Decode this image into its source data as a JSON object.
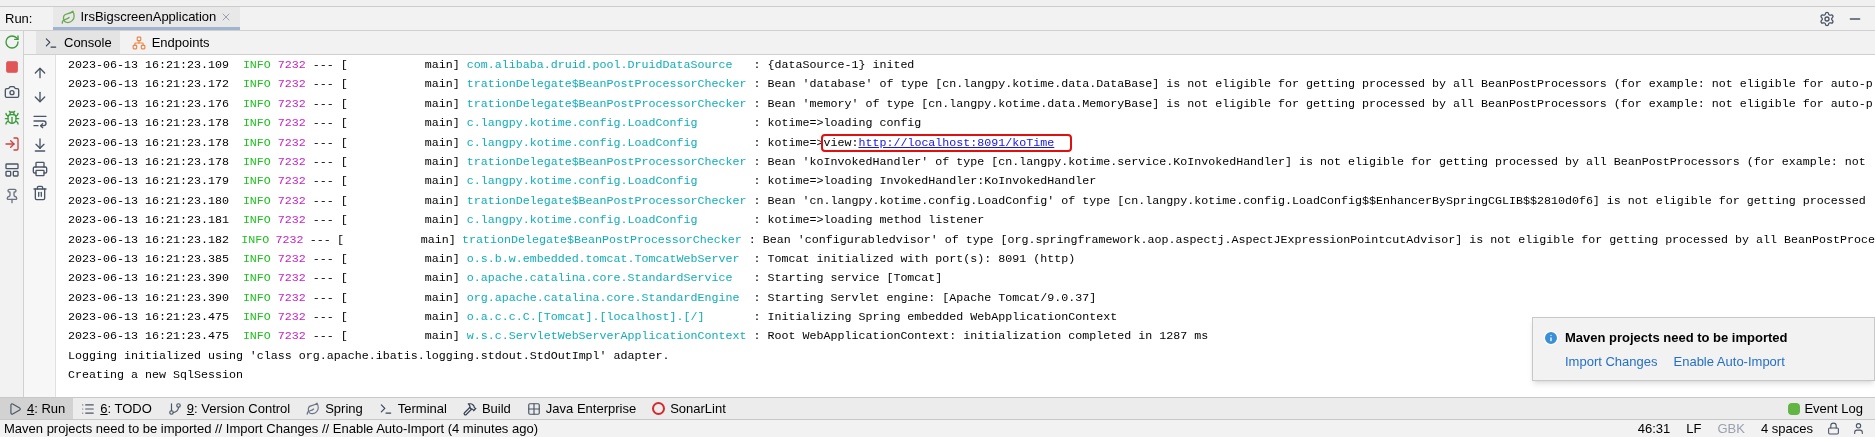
{
  "run_bar": {
    "label": "Run:",
    "tabs": [
      {
        "label": "IrsBigscreenApplication",
        "selected": true
      }
    ]
  },
  "console_tabs": [
    {
      "label": "Console",
      "selected": true
    },
    {
      "label": "Endpoints",
      "selected": false
    }
  ],
  "log_rows": [
    {
      "kind": "log",
      "time": "2023-06-13 16:21:23.109",
      "level": "INFO",
      "pid": "7232",
      "separator": "---",
      "thread": "[           main]",
      "logger": "com.alibaba.druid.pool.DruidDataSource",
      "message": ": {dataSource-1} inited"
    },
    {
      "kind": "log",
      "time": "2023-06-13 16:21:23.172",
      "level": "INFO",
      "pid": "7232",
      "separator": "---",
      "thread": "[           main]",
      "logger": "trationDelegate$BeanPostProcessorChecker",
      "message": ": Bean 'database' of type [cn.langpy.kotime.data.DataBase] is not eligible for getting processed by all BeanPostProcessors (for example: not eligible for auto-p"
    },
    {
      "kind": "log",
      "time": "2023-06-13 16:21:23.176",
      "level": "INFO",
      "pid": "7232",
      "separator": "---",
      "thread": "[           main]",
      "logger": "trationDelegate$BeanPostProcessorChecker",
      "message": ": Bean 'memory' of type [cn.langpy.kotime.data.MemoryBase] is not eligible for getting processed by all BeanPostProcessors (for example: not eligible for auto-p"
    },
    {
      "kind": "log",
      "time": "2023-06-13 16:21:23.178",
      "level": "INFO",
      "pid": "7232",
      "separator": "---",
      "thread": "[           main]",
      "logger": "c.langpy.kotime.config.LoadConfig",
      "message": ": kotime=>loading config"
    },
    {
      "kind": "log",
      "time": "2023-06-13 16:21:23.178",
      "level": "INFO",
      "pid": "7232",
      "separator": "---",
      "thread": "[           main]",
      "logger": "c.langpy.kotime.config.LoadConfig",
      "message": ": kotime=>",
      "boxed_text": "view:",
      "link": "http://localhost:8091/koTime"
    },
    {
      "kind": "log",
      "time": "2023-06-13 16:21:23.178",
      "level": "INFO",
      "pid": "7232",
      "separator": "---",
      "thread": "[           main]",
      "logger": "trationDelegate$BeanPostProcessorChecker",
      "message": ": Bean 'koInvokedHandler' of type [cn.langpy.kotime.service.KoInvokedHandler] is not eligible for getting processed by all BeanPostProcessors (for example: not"
    },
    {
      "kind": "log",
      "time": "2023-06-13 16:21:23.179",
      "level": "INFO",
      "pid": "7232",
      "separator": "---",
      "thread": "[           main]",
      "logger": "c.langpy.kotime.config.LoadConfig",
      "message": ": kotime=>loading InvokedHandler:KoInvokedHandler"
    },
    {
      "kind": "log",
      "time": "2023-06-13 16:21:23.180",
      "level": "INFO",
      "pid": "7232",
      "separator": "---",
      "thread": "[           main]",
      "logger": "trationDelegate$BeanPostProcessorChecker",
      "message": ": Bean 'cn.langpy.kotime.config.LoadConfig' of type [cn.langpy.kotime.config.LoadConfig$$EnhancerBySpringCGLIB$$2810d0f6] is not eligible for getting processed"
    },
    {
      "kind": "log",
      "time": "2023-06-13 16:21:23.181",
      "level": "INFO",
      "pid": "7232",
      "separator": "---",
      "thread": "[           main]",
      "logger": "c.langpy.kotime.config.LoadConfig",
      "message": ": kotime=>loading method listener"
    },
    {
      "kind": "log",
      "time": "2023-06-13 16:21:23.182",
      "level": "INFO",
      "pid": "7232",
      "separator": "---",
      "thread": "[           main]",
      "logger": "trationDelegate$BeanPostProcessorChecker",
      "message": ": Bean 'configurabledvisor' of type [org.springframework.aop.aspectj.AspectJExpressionPointcutAdvisor] is not eligible for getting processed by all BeanPostProce"
    },
    {
      "kind": "log",
      "time": "2023-06-13 16:21:23.385",
      "level": "INFO",
      "pid": "7232",
      "separator": "---",
      "thread": "[           main]",
      "logger": "o.s.b.w.embedded.tomcat.TomcatWebServer",
      "message": ": Tomcat initialized with port(s): 8091 (http)"
    },
    {
      "kind": "log",
      "time": "2023-06-13 16:21:23.390",
      "level": "INFO",
      "pid": "7232",
      "separator": "---",
      "thread": "[           main]",
      "logger": "o.apache.catalina.core.StandardService",
      "message": ": Starting service [Tomcat]"
    },
    {
      "kind": "log",
      "time": "2023-06-13 16:21:23.390",
      "level": "INFO",
      "pid": "7232",
      "separator": "---",
      "thread": "[           main]",
      "logger": "org.apache.catalina.core.StandardEngine",
      "message": ": Starting Servlet engine: [Apache Tomcat/9.0.37]"
    },
    {
      "kind": "log",
      "time": "2023-06-13 16:21:23.475",
      "level": "INFO",
      "pid": "7232",
      "separator": "---",
      "thread": "[           main]",
      "logger": "o.a.c.c.C.[Tomcat].[localhost].[/]",
      "message": ": Initializing Spring embedded WebApplicationContext"
    },
    {
      "kind": "log",
      "time": "2023-06-13 16:21:23.475",
      "level": "INFO",
      "pid": "7232",
      "separator": "---",
      "thread": "[           main]",
      "logger": "w.s.c.ServletWebServerApplicationContext",
      "message": ": Root WebApplicationContext: initialization completed in 1287 ms"
    },
    {
      "kind": "plain",
      "text": "Logging initialized using 'class org.apache.ibatis.logging.stdout.StdOutImpl' adapter."
    },
    {
      "kind": "plain",
      "text": "Creating a new SqlSession"
    }
  ],
  "notification": {
    "title": "Maven projects need to be imported",
    "actions": [
      "Import Changes",
      "Enable Auto-Import"
    ]
  },
  "tool_windows": [
    {
      "kind": "run",
      "key": "4",
      "label": ": Run",
      "selected": true
    },
    {
      "kind": "todo",
      "key": "6",
      "label": ": TODO",
      "selected": false
    },
    {
      "kind": "vcs",
      "key": "9",
      "label": ": Version Control",
      "selected": false
    },
    {
      "kind": "spring",
      "label": "Spring",
      "selected": false
    },
    {
      "kind": "terminal",
      "label": "Terminal",
      "selected": false
    },
    {
      "kind": "build",
      "label": "Build",
      "selected": false
    },
    {
      "kind": "javaee",
      "label": "Java Enterprise",
      "selected": false
    },
    {
      "kind": "sonar",
      "label": "SonarLint",
      "selected": false
    }
  ],
  "event_log": "Event Log",
  "status_bar": {
    "message": "Maven projects need to be imported // Import Changes // Enable Auto-Import (4 minutes ago)",
    "items": [
      {
        "label": "46:31",
        "disabled": false
      },
      {
        "label": "LF",
        "disabled": false
      },
      {
        "label": "GBK",
        "disabled": true
      },
      {
        "label": "4 spaces",
        "disabled": false
      }
    ]
  }
}
